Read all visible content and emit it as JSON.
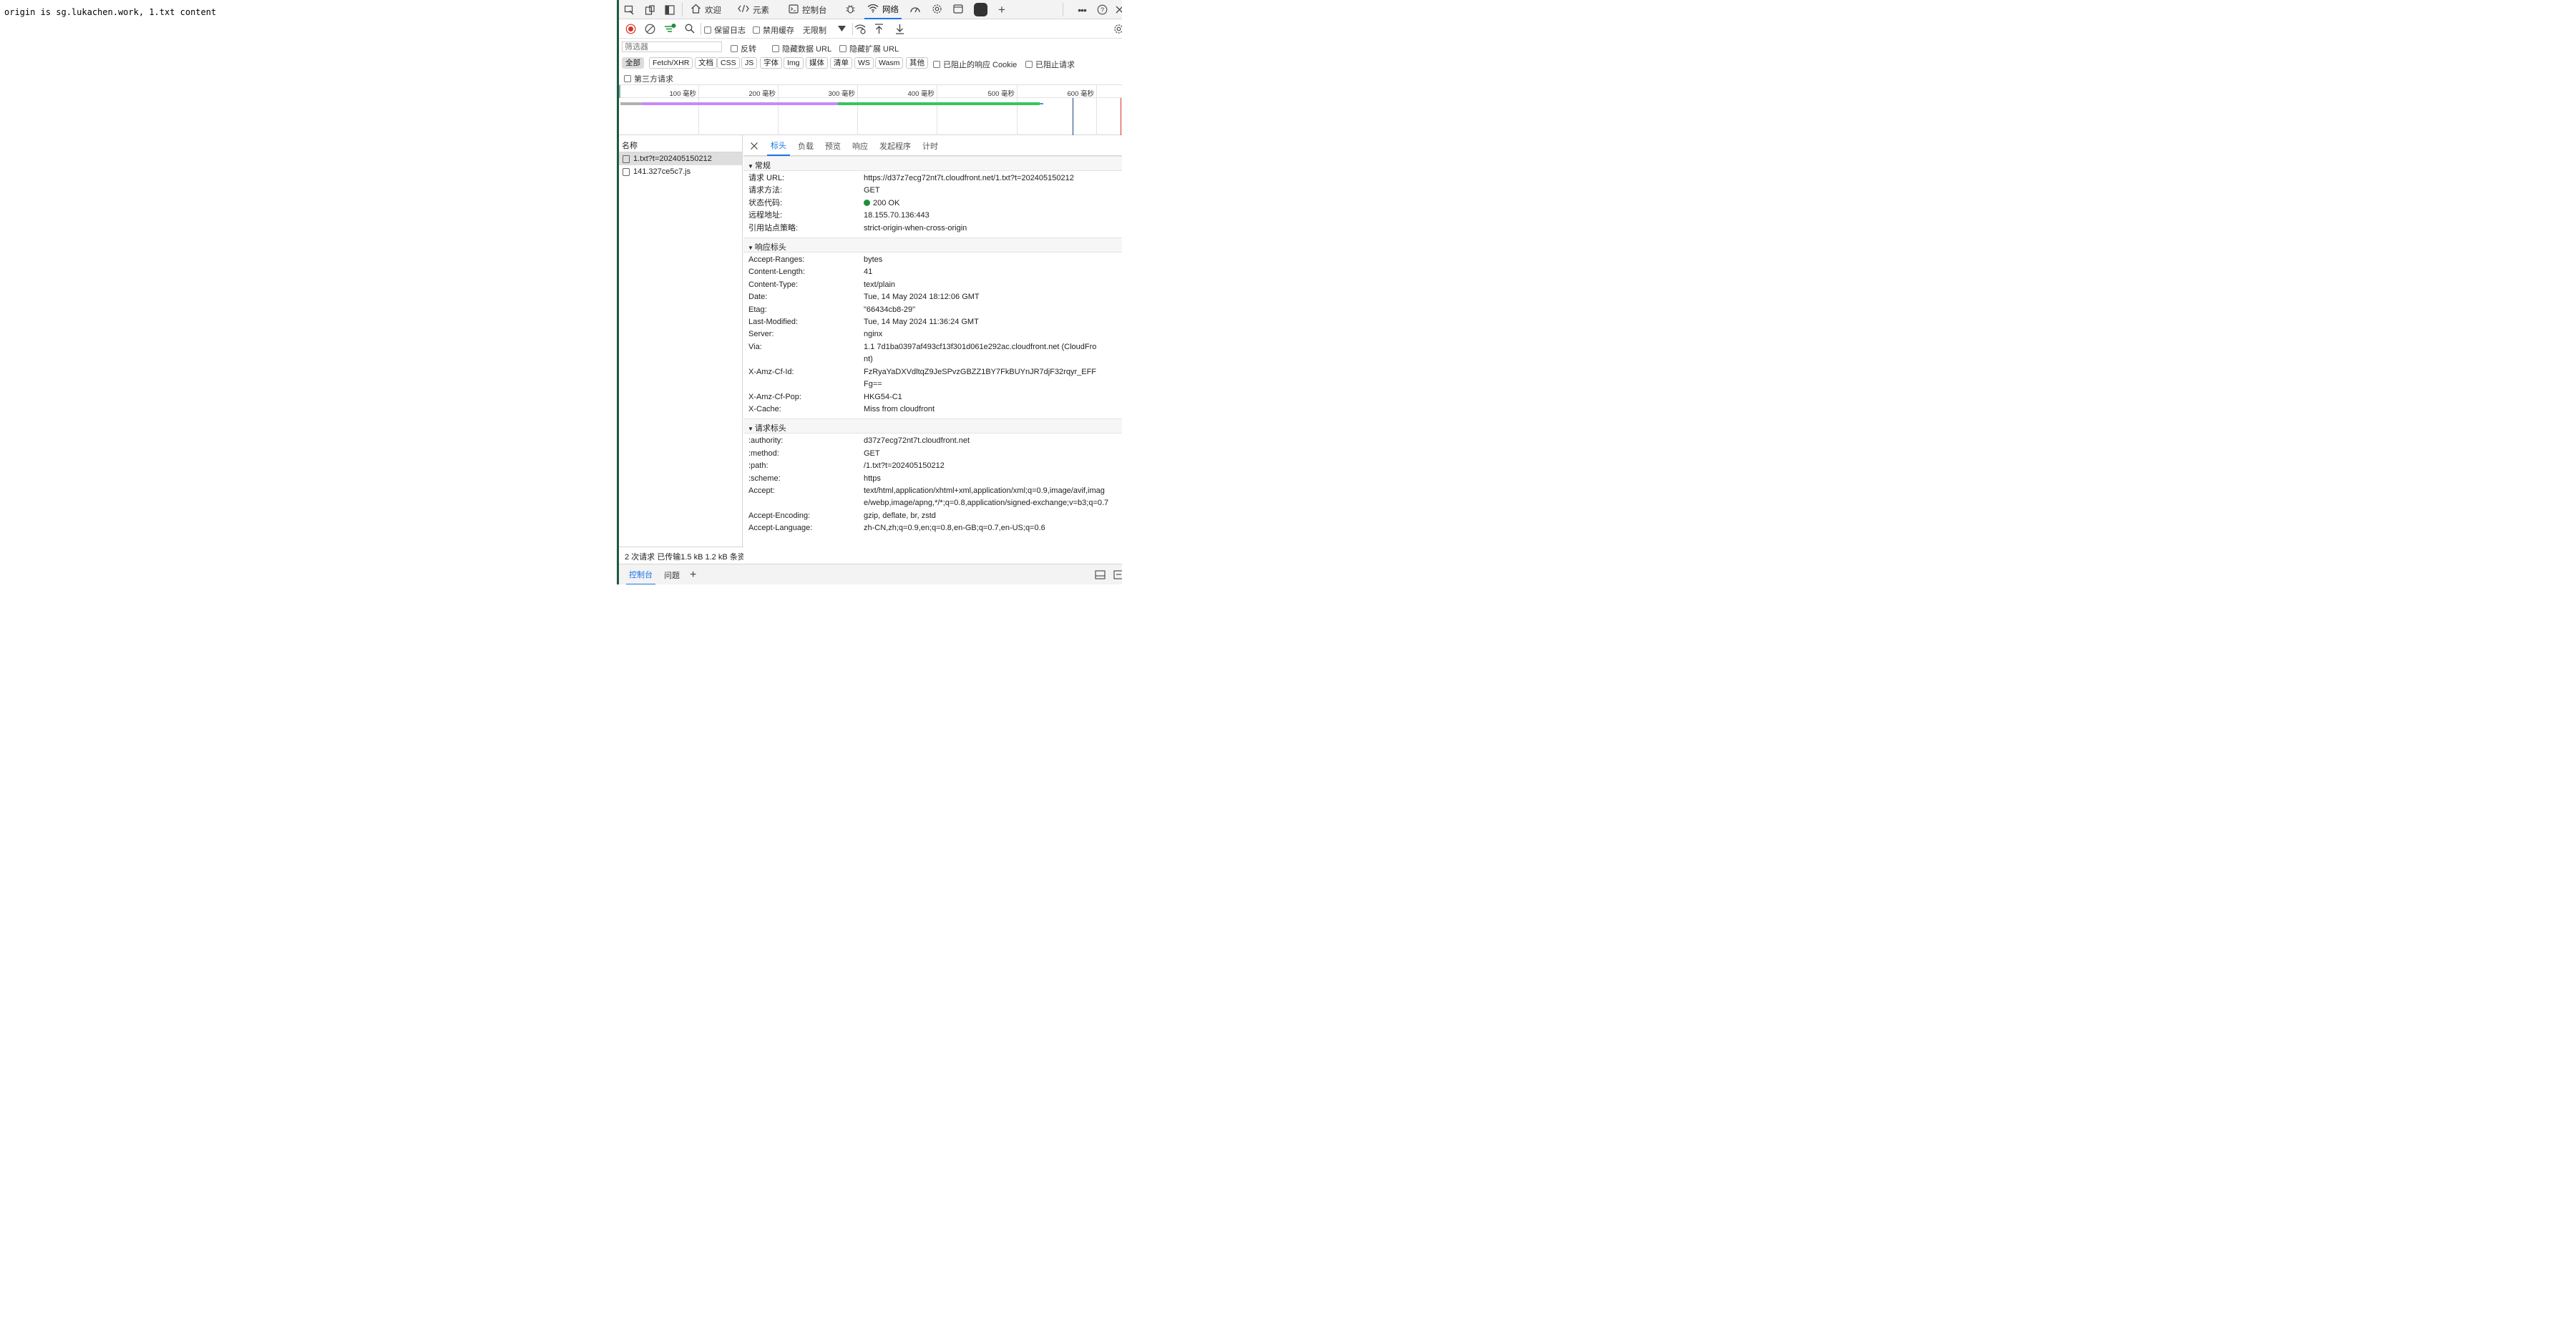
{
  "page": {
    "text": "origin is sg.lukachen.work, 1.txt content"
  },
  "devtools": {
    "main_tabs": [
      {
        "label": "欢迎"
      },
      {
        "label": "元素"
      },
      {
        "label": "控制台"
      },
      {
        "label": "网络"
      }
    ],
    "toolbar": {
      "preserve_log": "保留日志",
      "disable_cache": "禁用缓存",
      "throttle": "无限制"
    },
    "filter": {
      "placeholder": "筛选器",
      "invert": "反转",
      "hide_data_url": "隐藏数据 URL",
      "hide_ext_url": "隐藏扩展 URL",
      "types": [
        "全部",
        "Fetch/XHR",
        "文档",
        "CSS",
        "JS",
        "字体",
        "Img",
        "媒体",
        "清单",
        "WS",
        "Wasm",
        "其他"
      ],
      "blocked_cookies": "已阻止的响应 Cookie",
      "blocked_requests": "已阻止请求",
      "third_party": "第三方请求"
    },
    "timeline": {
      "ticks": [
        "100 毫秒",
        "200 毫秒",
        "300 毫秒",
        "400 毫秒",
        "500 毫秒",
        "600 毫秒"
      ]
    },
    "list": {
      "header": "名称",
      "rows": [
        "1.txt?t=202405150212",
        "141.327ce5c7.js"
      ],
      "summary": "2 次请求  已传输1.5 kB  1.2 kB 条资源"
    },
    "detail": {
      "tabs": [
        "标头",
        "负载",
        "预览",
        "响应",
        "发起程序",
        "计时"
      ],
      "general": {
        "title": "常规",
        "rows": [
          {
            "k": "请求 URL:",
            "v": "https://d37z7ecg72nt7t.cloudfront.net/1.txt?t=202405150212"
          },
          {
            "k": "请求方法:",
            "v": "GET"
          },
          {
            "k": "状态代码:",
            "v": "200 OK"
          },
          {
            "k": "远程地址:",
            "v": "18.155.70.136:443"
          },
          {
            "k": "引用站点策略:",
            "v": "strict-origin-when-cross-origin"
          }
        ]
      },
      "response": {
        "title": "响应标头",
        "rows": [
          {
            "k": "Accept-Ranges:",
            "v": "bytes"
          },
          {
            "k": "Content-Length:",
            "v": "41"
          },
          {
            "k": "Content-Type:",
            "v": "text/plain"
          },
          {
            "k": "Date:",
            "v": "Tue, 14 May 2024 18:12:06 GMT"
          },
          {
            "k": "Etag:",
            "v": "\"66434cb8-29\""
          },
          {
            "k": "Last-Modified:",
            "v": "Tue, 14 May 2024 11:36:24 GMT"
          },
          {
            "k": "Server:",
            "v": "nginx"
          },
          {
            "k": "Via:",
            "v": "1.1 7d1ba0397af493cf13f301d061e292ac.cloudfront.net (CloudFront)"
          },
          {
            "k": "X-Amz-Cf-Id:",
            "v": "FzRyaYaDXVdltqZ9JeSPvzGBZZ1BY7FkBUYnJR7djF32rqyr_EFFFg=="
          },
          {
            "k": "X-Amz-Cf-Pop:",
            "v": "HKG54-C1"
          },
          {
            "k": "X-Cache:",
            "v": "Miss from cloudfront"
          }
        ]
      },
      "request": {
        "title": "请求标头",
        "rows": [
          {
            "k": ":authority:",
            "v": "d37z7ecg72nt7t.cloudfront.net"
          },
          {
            "k": ":method:",
            "v": "GET"
          },
          {
            "k": ":path:",
            "v": "/1.txt?t=202405150212"
          },
          {
            "k": ":scheme:",
            "v": "https"
          },
          {
            "k": "Accept:",
            "v": "text/html,application/xhtml+xml,application/xml;q=0.9,image/avif,image/webp,image/apng,*/*;q=0.8,application/signed-exchange;v=b3;q=0.7"
          },
          {
            "k": "Accept-Encoding:",
            "v": "gzip, deflate, br, zstd"
          },
          {
            "k": "Accept-Language:",
            "v": "zh-CN,zh;q=0.9,en;q=0.8,en-GB;q=0.7,en-US;q=0.6"
          }
        ]
      }
    },
    "drawer": {
      "tabs": [
        "控制台",
        "问题"
      ]
    },
    "colors": {
      "accent": "#1a73e8",
      "status_ok": "#1e8e3e",
      "record": "#d93025"
    }
  }
}
